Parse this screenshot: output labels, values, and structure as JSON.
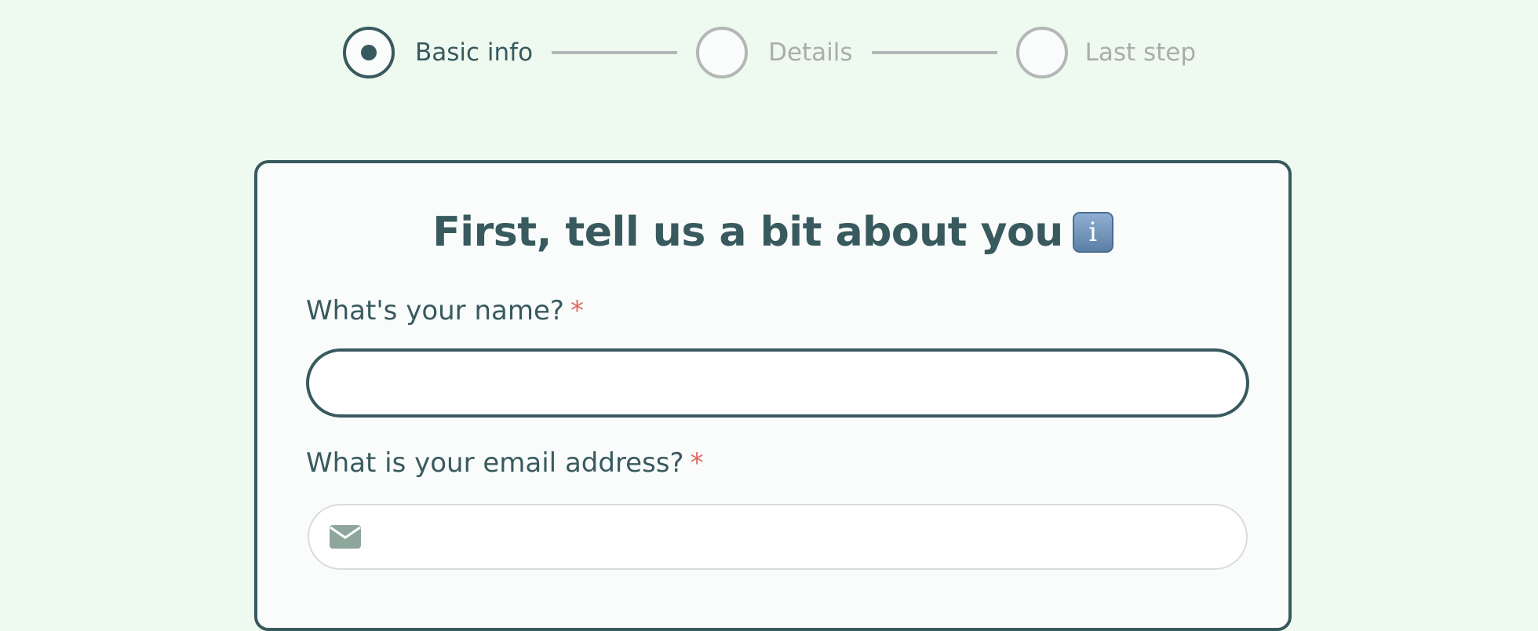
{
  "stepper": {
    "steps": [
      {
        "label": "Basic info",
        "state": "active"
      },
      {
        "label": "Details",
        "state": "inactive"
      },
      {
        "label": "Last step",
        "state": "inactive"
      }
    ]
  },
  "form": {
    "title": "First, tell us a bit about you",
    "title_icon": "info-icon",
    "name_field": {
      "label": "What's your name?",
      "required_mark": "*",
      "value": ""
    },
    "email_field": {
      "label": "What is your email address?",
      "required_mark": "*",
      "value": "",
      "icon": "envelope-icon"
    }
  },
  "colors": {
    "background": "#eef9f0",
    "primary": "#385a5e",
    "inactive": "#b3b7b6",
    "required": "#e06a63",
    "card": "#f9fcfb"
  }
}
